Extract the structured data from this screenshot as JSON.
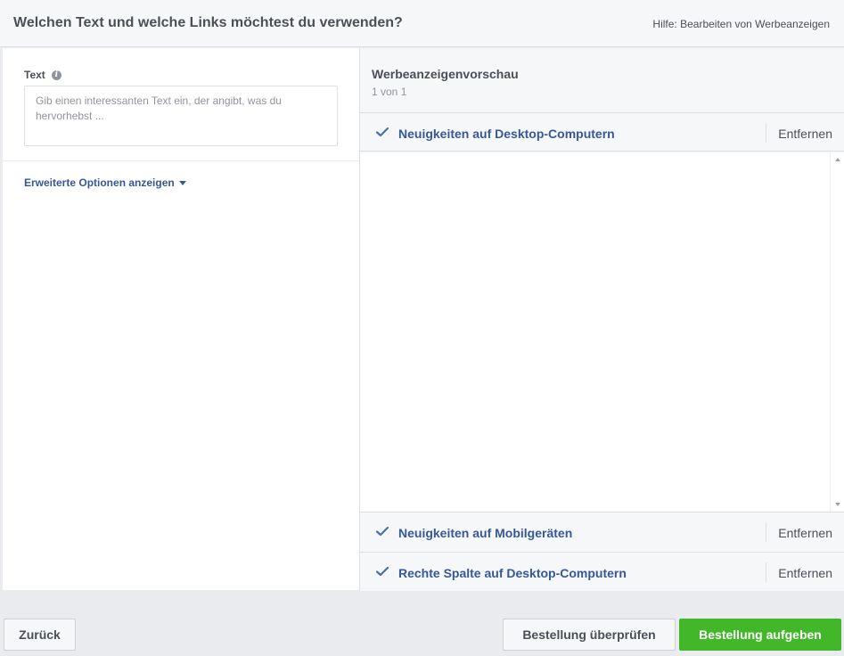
{
  "header": {
    "title": "Welchen Text und welche Links möchtest du verwenden?",
    "help_link": "Hilfe: Bearbeiten von Werbeanzeigen"
  },
  "left": {
    "text_label": "Text",
    "info_icon": "info-icon",
    "text_placeholder": "Gib einen interessanten Text ein, der angibt, was du hervorhebst ...",
    "advanced_options": "Erweiterte Optionen anzeigen"
  },
  "preview": {
    "title": "Werbeanzeigenvorschau",
    "count": "1 von 1",
    "placements": [
      {
        "label": "Neuigkeiten auf Desktop-Computern",
        "remove": "Entfernen"
      },
      {
        "label": "Neuigkeiten auf Mobilgeräten",
        "remove": "Entfernen"
      },
      {
        "label": "Rechte Spalte auf Desktop-Computern",
        "remove": "Entfernen"
      }
    ]
  },
  "footer": {
    "back": "Zurück",
    "review": "Bestellung überprüfen",
    "order": "Bestellung aufgeben"
  },
  "colors": {
    "link_blue": "#365899",
    "primary_green": "#42b72a",
    "text_gray": "#4b4f56"
  }
}
